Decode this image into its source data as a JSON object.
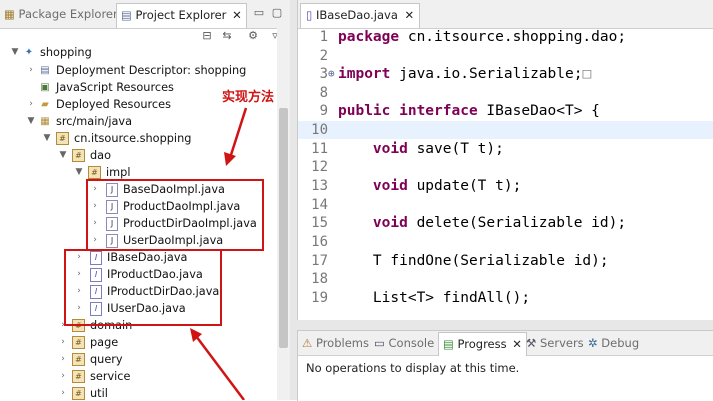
{
  "left_tabs": [
    {
      "label": "Package Explorer",
      "active": false
    },
    {
      "label": "Project Explorer",
      "active": true
    }
  ],
  "tree": [
    {
      "label": "shopping",
      "icon": "project-icon"
    },
    {
      "label": "Deployment Descriptor: shopping",
      "icon": "deployment-icon"
    },
    {
      "label": "JavaScript Resources",
      "icon": "js-resources-icon"
    },
    {
      "label": "Deployed Resources",
      "icon": "deployed-icon"
    },
    {
      "label": "src/main/java",
      "icon": "source-folder-icon"
    },
    {
      "label": "cn.itsource.shopping",
      "icon": "package-icon"
    },
    {
      "label": "dao",
      "icon": "package-icon"
    },
    {
      "label": "impl",
      "icon": "package-icon"
    },
    {
      "label": "BaseDaoImpl.java",
      "icon": "java-file-icon"
    },
    {
      "label": "ProductDaoImpl.java",
      "icon": "java-file-icon"
    },
    {
      "label": "ProductDirDaoImpl.java",
      "icon": "java-file-icon"
    },
    {
      "label": "UserDaoImpl.java",
      "icon": "java-file-icon"
    },
    {
      "label": "IBaseDao.java",
      "icon": "interface-file-icon"
    },
    {
      "label": "IProductDao.java",
      "icon": "interface-file-icon"
    },
    {
      "label": "IProductDirDao.java",
      "icon": "interface-file-icon"
    },
    {
      "label": "IUserDao.java",
      "icon": "interface-file-icon"
    },
    {
      "label": "domain",
      "icon": "package-icon"
    },
    {
      "label": "page",
      "icon": "package-icon"
    },
    {
      "label": "query",
      "icon": "package-icon"
    },
    {
      "label": "service",
      "icon": "package-icon"
    },
    {
      "label": "util",
      "icon": "package-icon"
    }
  ],
  "annotation": {
    "text": "实现方法",
    "color": "#d01414"
  },
  "editor": {
    "tab_label": "IBaseDao.java",
    "lines": [
      {
        "no": "1",
        "kw": "package",
        "rest": " cn.itsource.shopping.dao;"
      },
      {
        "no": "2",
        "kw": "",
        "rest": ""
      },
      {
        "no": "3",
        "kw": "import",
        "rest": " java.io.Serializable;",
        "marker": "⊕",
        "folded": "□"
      },
      {
        "no": "8",
        "kw": "",
        "rest": ""
      },
      {
        "no": "9",
        "kw": "public interface",
        "rest": " IBaseDao<T> {"
      },
      {
        "no": "10",
        "kw": "",
        "rest": ""
      },
      {
        "no": "11",
        "kw": "",
        "rest": "    ",
        "kw2": "void",
        "rest2": " save(T t);"
      },
      {
        "no": "12",
        "kw": "",
        "rest": ""
      },
      {
        "no": "13",
        "kw": "",
        "rest": "    ",
        "kw2": "void",
        "rest2": " update(T t);"
      },
      {
        "no": "14",
        "kw": "",
        "rest": ""
      },
      {
        "no": "15",
        "kw": "",
        "rest": "    ",
        "kw2": "void",
        "rest2": " delete(Serializable id);"
      },
      {
        "no": "16",
        "kw": "",
        "rest": ""
      },
      {
        "no": "17",
        "kw": "",
        "rest": "    T findOne(Serializable id);"
      },
      {
        "no": "18",
        "kw": "",
        "rest": ""
      },
      {
        "no": "19",
        "kw": "",
        "rest": "    List<T> findAll();"
      }
    ]
  },
  "console_tabs": [
    {
      "label": "Problems",
      "active": false
    },
    {
      "label": "Console",
      "active": false
    },
    {
      "label": "Progress",
      "active": true
    },
    {
      "label": "Servers",
      "active": false
    },
    {
      "label": "Debug",
      "active": false
    }
  ],
  "console": {
    "message": "No operations to display at this time."
  },
  "colors": {
    "keyword": "#7f0055",
    "highlight": "#e8f2fe",
    "annotation": "#d01414"
  }
}
